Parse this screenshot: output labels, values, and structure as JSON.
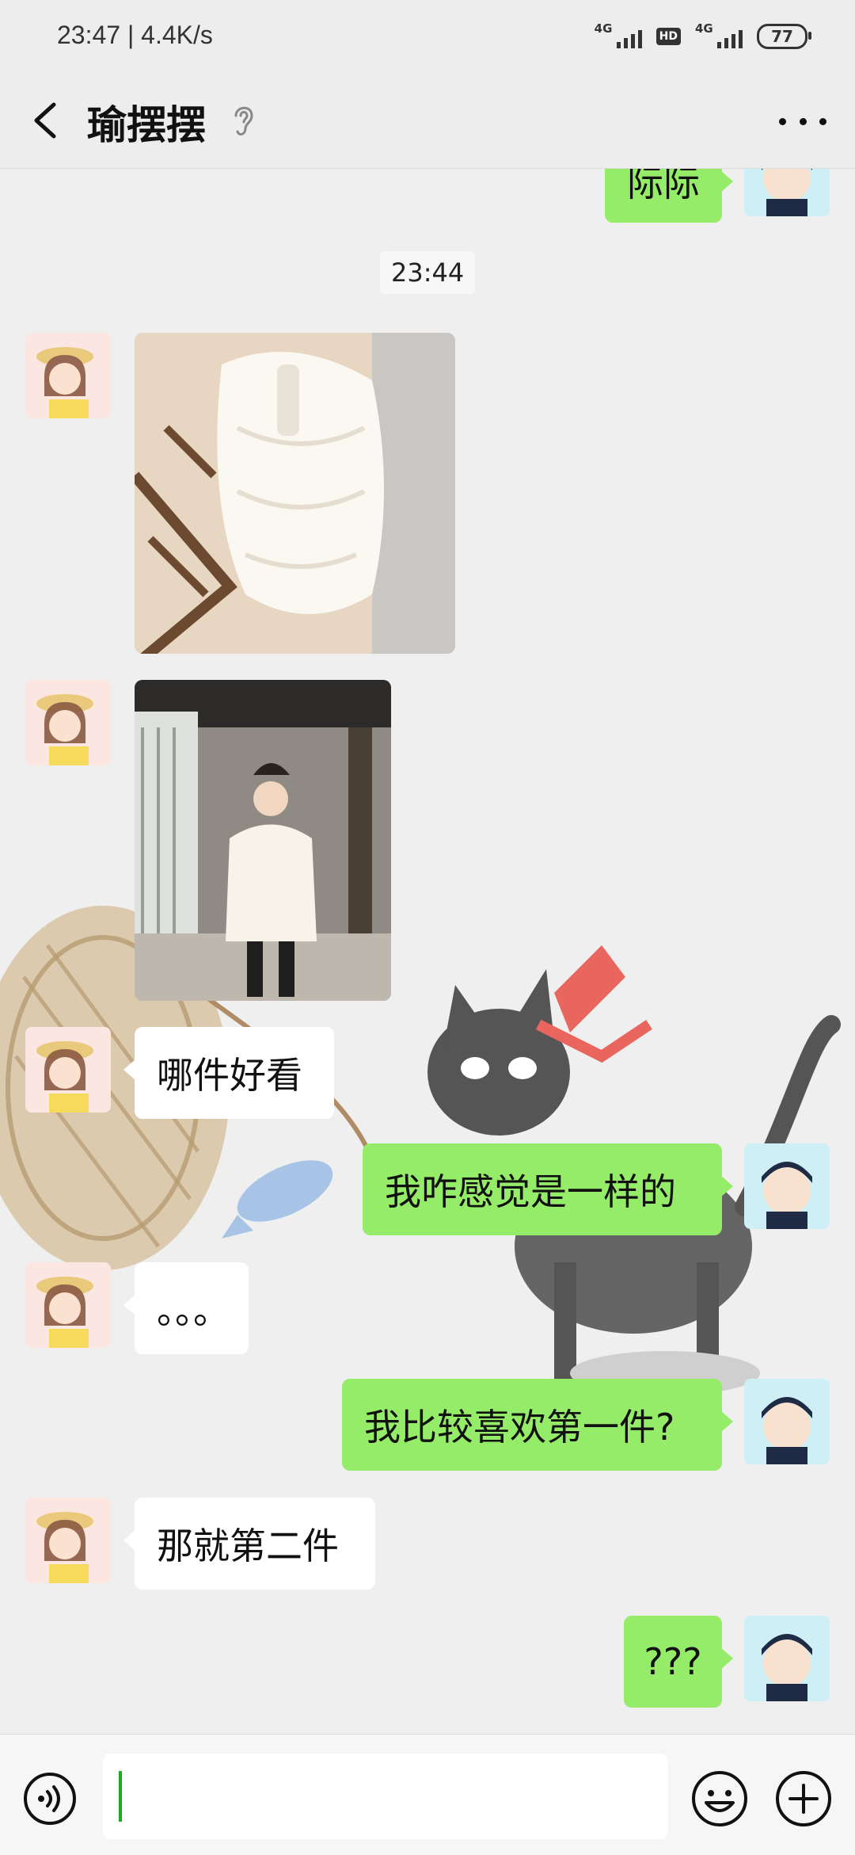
{
  "status_bar": {
    "time": "23:47 | 4.4K/s",
    "network_labels": [
      "4G",
      "4G"
    ],
    "hd_label": "HD",
    "battery": "77"
  },
  "header": {
    "title": "瑜摆摆"
  },
  "chat": {
    "timestamp": "23:44",
    "partial_top_message": "际际",
    "messages": [
      {
        "side": "left",
        "type": "image",
        "desc": "white puffer jacket photo"
      },
      {
        "side": "left",
        "type": "image",
        "desc": "woman in white jacket photo"
      },
      {
        "side": "left",
        "type": "text",
        "text": "哪件好看"
      },
      {
        "side": "right",
        "type": "text",
        "text": "我咋感觉是一样的"
      },
      {
        "side": "left",
        "type": "text",
        "text": "。。。"
      },
      {
        "side": "right",
        "type": "text",
        "text": "我比较喜欢第一件?"
      },
      {
        "side": "left",
        "type": "text",
        "text": "那就第二件"
      },
      {
        "side": "right",
        "type": "text",
        "text": "???"
      }
    ]
  },
  "colors": {
    "bubble_right": "#95ec69",
    "bubble_left": "#ffffff",
    "background": "#efefef",
    "caret": "#1aad19"
  },
  "icons": [
    "back-arrow-icon",
    "ear-icon",
    "more-icon",
    "voice-icon",
    "emoji-icon",
    "plus-icon"
  ]
}
